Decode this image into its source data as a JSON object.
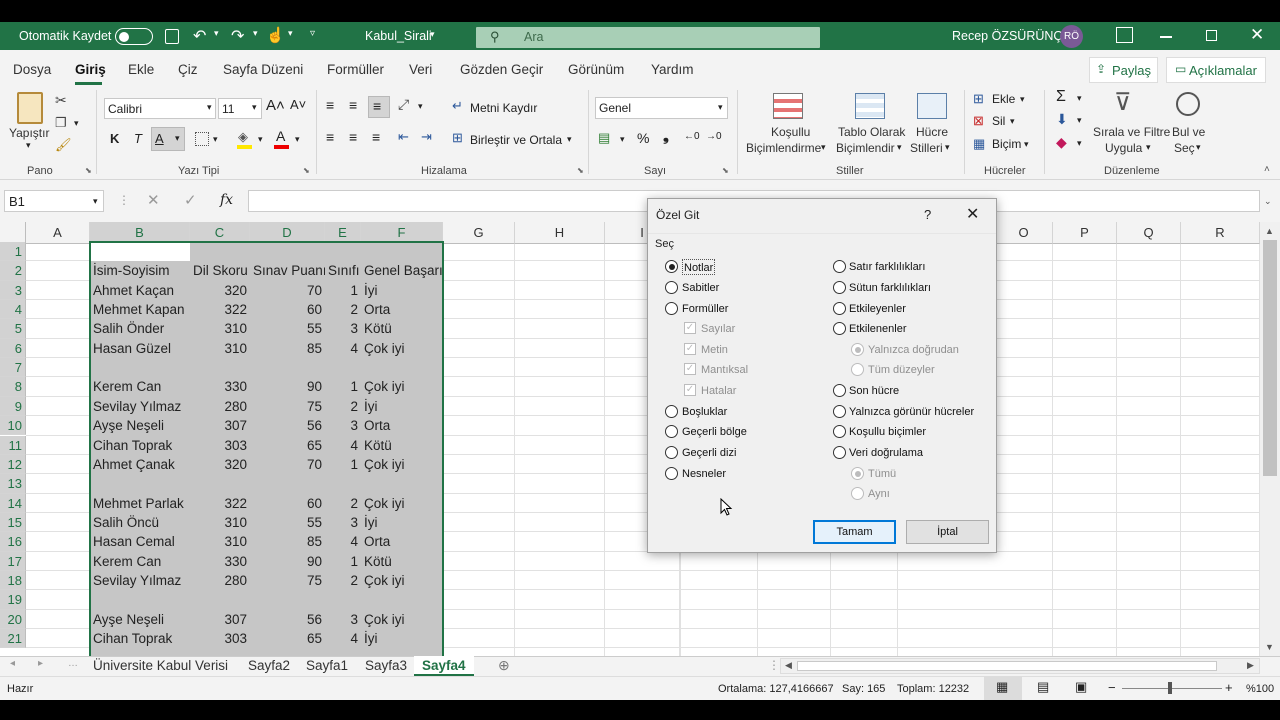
{
  "titlebar": {
    "autosave_label": "Otomatik Kaydet",
    "file_name": "Kabul_Sirali",
    "search_placeholder": "Ara",
    "user_name": "Recep ÖZSÜRÜNÇ",
    "user_initials": "RÖ"
  },
  "tabs": [
    "Dosya",
    "Giriş",
    "Ekle",
    "Çiz",
    "Sayfa Düzeni",
    "Formüller",
    "Veri",
    "Gözden Geçir",
    "Görünüm",
    "Yardım"
  ],
  "share_label": "Paylaş",
  "comments_label": "Açıklamalar",
  "ribbon": {
    "paste_label": "Yapıştır",
    "group_pano": "Pano",
    "font_name": "Calibri",
    "font_size": "11",
    "bold": "K",
    "italic": "T",
    "underline": "A",
    "group_font": "Yazı Tipi",
    "wrap_text": "Metni Kaydır",
    "merge_center": "Birleştir ve Ortala",
    "group_alignment": "Hizalama",
    "number_format": "Genel",
    "group_number": "Sayı",
    "cond_format_1": "Koşullu",
    "cond_format_2": "Biçimlendirme",
    "table_format_1": "Tablo Olarak",
    "table_format_2": "Biçimlendir",
    "cell_styles_1": "Hücre",
    "cell_styles_2": "Stilleri",
    "group_styles": "Stiller",
    "insert": "Ekle",
    "delete": "Sil",
    "format": "Biçim",
    "group_cells": "Hücreler",
    "sort_filter_1": "Sırala ve Filtre",
    "sort_filter_2": "Uygula",
    "find_select_1": "Bul ve",
    "find_select_2": "Seç",
    "group_editing": "Düzenleme"
  },
  "formula_bar": {
    "name_box": "B1",
    "fx": "fx",
    "content": ""
  },
  "columns": [
    "A",
    "B",
    "C",
    "D",
    "E",
    "F",
    "G",
    "H",
    "I",
    "O",
    "P",
    "Q",
    "R"
  ],
  "rows": [
    "1",
    "2",
    "3",
    "4",
    "5",
    "6",
    "7",
    "8",
    "9",
    "10",
    "11",
    "12",
    "13",
    "14",
    "15",
    "16",
    "17",
    "18",
    "19",
    "20",
    "21"
  ],
  "table": [
    [
      "",
      "",
      "",
      "",
      ""
    ],
    [
      "İsim-Soyisim",
      "Dil Skoru",
      "Sınav Puanı",
      "Sınıfı",
      "Genel Başarı"
    ],
    [
      "Ahmet Kaçan",
      "320",
      "70",
      "1",
      "İyi"
    ],
    [
      "Mehmet Kapan",
      "322",
      "60",
      "2",
      "Orta"
    ],
    [
      "Salih Önder",
      "310",
      "55",
      "3",
      "Kötü"
    ],
    [
      "Hasan Güzel",
      "310",
      "85",
      "4",
      "Çok iyi"
    ],
    [
      "",
      "",
      "",
      "",
      ""
    ],
    [
      "Kerem Can",
      "330",
      "90",
      "1",
      "Çok iyi"
    ],
    [
      "Sevilay Yılmaz",
      "280",
      "75",
      "2",
      "İyi"
    ],
    [
      "Ayşe Neşeli",
      "307",
      "56",
      "3",
      "Orta"
    ],
    [
      "Cihan Toprak",
      "303",
      "65",
      "4",
      "Kötü"
    ],
    [
      "Ahmet Çanak",
      "320",
      "70",
      "1",
      "Çok iyi"
    ],
    [
      "",
      "",
      "",
      "",
      ""
    ],
    [
      "Mehmet Parlak",
      "322",
      "60",
      "2",
      "Çok iyi"
    ],
    [
      "Salih Öncü",
      "310",
      "55",
      "3",
      "İyi"
    ],
    [
      "Hasan Cemal",
      "310",
      "85",
      "4",
      "Orta"
    ],
    [
      "Kerem Can",
      "330",
      "90",
      "1",
      "Kötü"
    ],
    [
      "Sevilay Yılmaz",
      "280",
      "75",
      "2",
      "Çok iyi"
    ],
    [
      "",
      "",
      "",
      "",
      ""
    ],
    [
      "Ayşe Neşeli",
      "307",
      "56",
      "3",
      "Çok iyi"
    ],
    [
      "Cihan Toprak",
      "303",
      "65",
      "4",
      "İyi"
    ]
  ],
  "dialog": {
    "title": "Özel Git",
    "help": "?",
    "section": "Seç",
    "left_options": [
      "Notlar",
      "Sabitler",
      "Formüller"
    ],
    "formula_checks": [
      "Sayılar",
      "Metin",
      "Mantıksal",
      "Hatalar"
    ],
    "left_options2": [
      "Boşluklar",
      "Geçerli bölge",
      "Geçerli dizi",
      "Nesneler"
    ],
    "right_options": [
      "Satır farklılıkları",
      "Sütun farklılıkları",
      "Etkileyenler",
      "Etkilenenler"
    ],
    "dependents_sub": [
      "Yalnızca doğrudan",
      "Tüm düzeyler"
    ],
    "right_options2": [
      "Son hücre",
      "Yalnızca görünür hücreler",
      "Koşullu biçimler",
      "Veri doğrulama"
    ],
    "validation_sub": [
      "Tümü",
      "Aynı"
    ],
    "selected": "Notlar",
    "ok": "Tamam",
    "cancel": "İptal"
  },
  "sheets": [
    "Üniversite Kabul Verisi",
    "Sayfa2",
    "Sayfa1",
    "Sayfa3",
    "Sayfa4"
  ],
  "active_sheet": "Sayfa4",
  "status": {
    "ready": "Hazır",
    "average": "Ortalama: 127,4166667",
    "count": "Say: 165",
    "sum": "Toplam: 12232",
    "zoom": "%100"
  },
  "colors": {
    "excel_green": "#217346",
    "selection_fill": "#c6c6c6",
    "accent_red": "#c0392b"
  }
}
